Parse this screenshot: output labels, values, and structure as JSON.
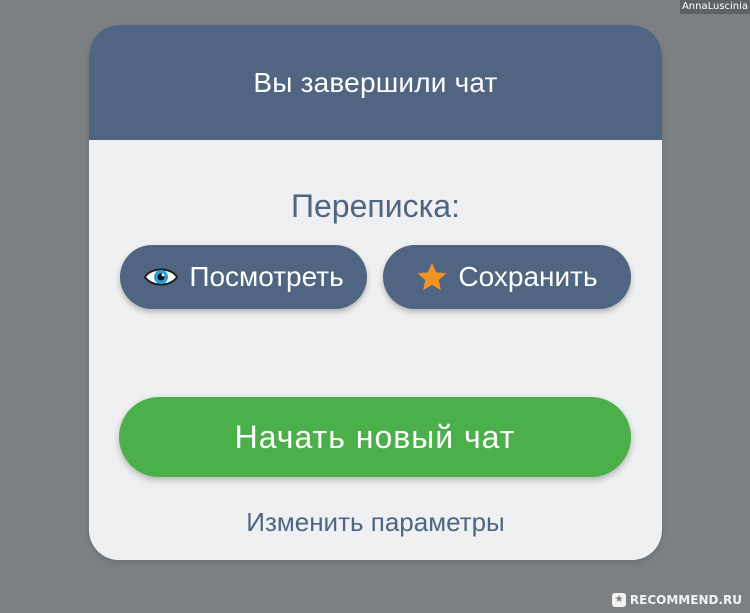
{
  "watermark": {
    "top_text": "AnnaLuscinia",
    "bottom_text": "RECOMMEND.RU"
  },
  "dialog": {
    "title": "Вы завершили чат",
    "transcript_label": "Переписка:",
    "view_button_label": "Посмотреть",
    "save_button_label": "Сохранить",
    "new_chat_button_label": "Начать новый чат",
    "change_params_link": "Изменить параметры"
  },
  "icons": {
    "view": "eye-icon",
    "save": "star-icon"
  },
  "colors": {
    "background": "#7d8083",
    "header": "#4f6582",
    "dialog_body": "#eef0f1",
    "secondary_button": "#4f6582",
    "primary_button": "#4cb04a",
    "star": "#f39323",
    "eye_iris": "#2a9fd6"
  }
}
